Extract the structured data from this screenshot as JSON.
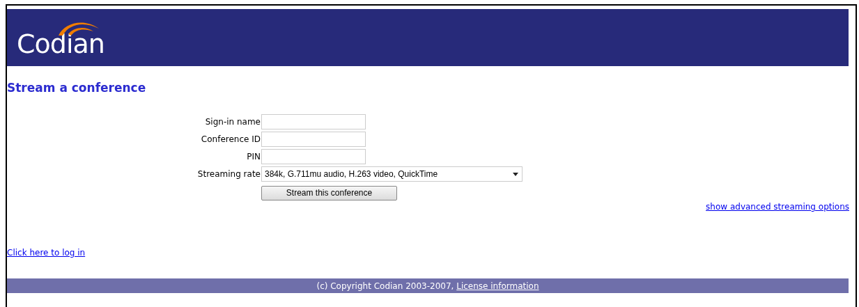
{
  "header": {
    "logo_text": "Codian"
  },
  "page_title": "Stream a conference",
  "form": {
    "fields": [
      {
        "kind": "text",
        "label": "Sign-in name"
      },
      {
        "kind": "text",
        "label": "Conference ID"
      },
      {
        "kind": "text",
        "label": "PIN"
      },
      {
        "kind": "select",
        "label": "Streaming rate",
        "value": "384k, G.711mu audio, H.263 video, QuickTime"
      }
    ],
    "submit": "Stream this conference"
  },
  "advanced_link": "show advanced streaming options",
  "login_link": "Click here to log in",
  "footer": {
    "text": "(c) Copyright Codian 2003-2007,",
    "link": "License information"
  }
}
